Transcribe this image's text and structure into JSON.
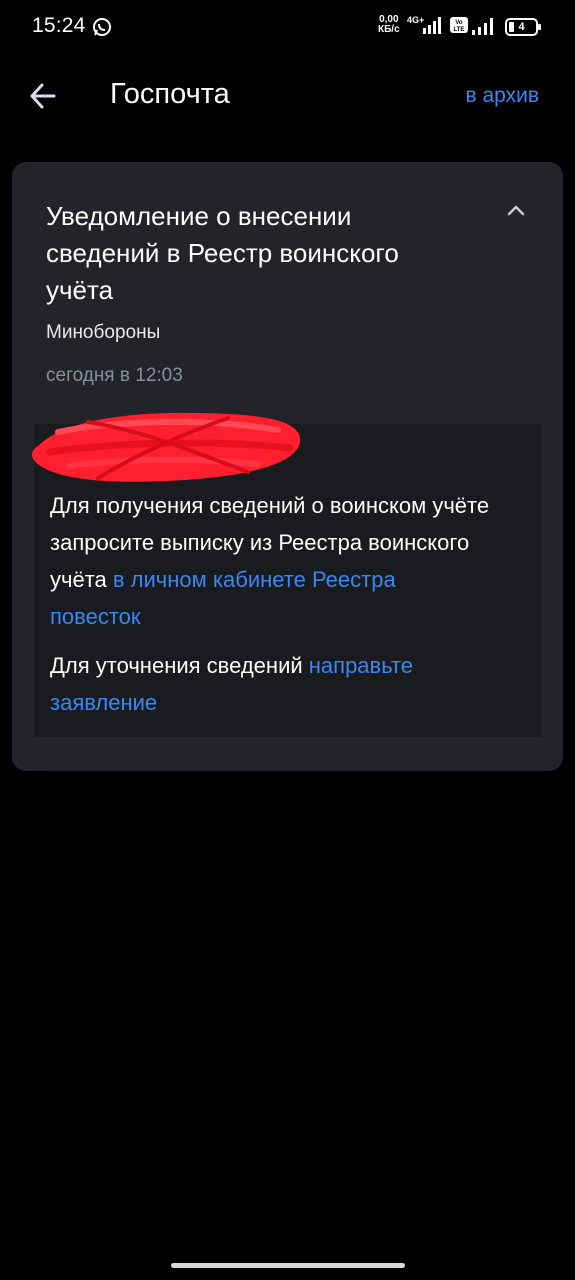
{
  "status_bar": {
    "time": "15:24",
    "net_speed_value": "0,00",
    "net_speed_unit": "КБ/с",
    "network_label": "4G+",
    "volte_label": "Vo LTE",
    "battery_level": "4",
    "icons": [
      "whatsapp-icon",
      "signal-icon",
      "volte-icon",
      "signal-icon",
      "battery-icon"
    ]
  },
  "header": {
    "title": "Госпочта",
    "archive_label": "в архив",
    "back_icon": "arrow-left-icon"
  },
  "message": {
    "title": "Уведомление о внесении сведений в Реестр воинского учёта",
    "sender": "Минобороны",
    "date": "сегодня в 12:03",
    "paragraph1_text": "Для получения сведений о воинском учёте запросите выписку из Реестра воинского учёта ",
    "paragraph1_link": "в личном кабинете Реестра повесток",
    "paragraph2_text": "Для уточнения сведений ",
    "paragraph2_link": "направьте заявление",
    "collapse_icon": "chevron-up-icon"
  },
  "colors": {
    "background": "#000000",
    "card": "#232429",
    "message_box": "#1a1b1f",
    "link": "#3a86f2",
    "muted_text": "#8a8f9c",
    "redaction": "#ff1f2f"
  }
}
